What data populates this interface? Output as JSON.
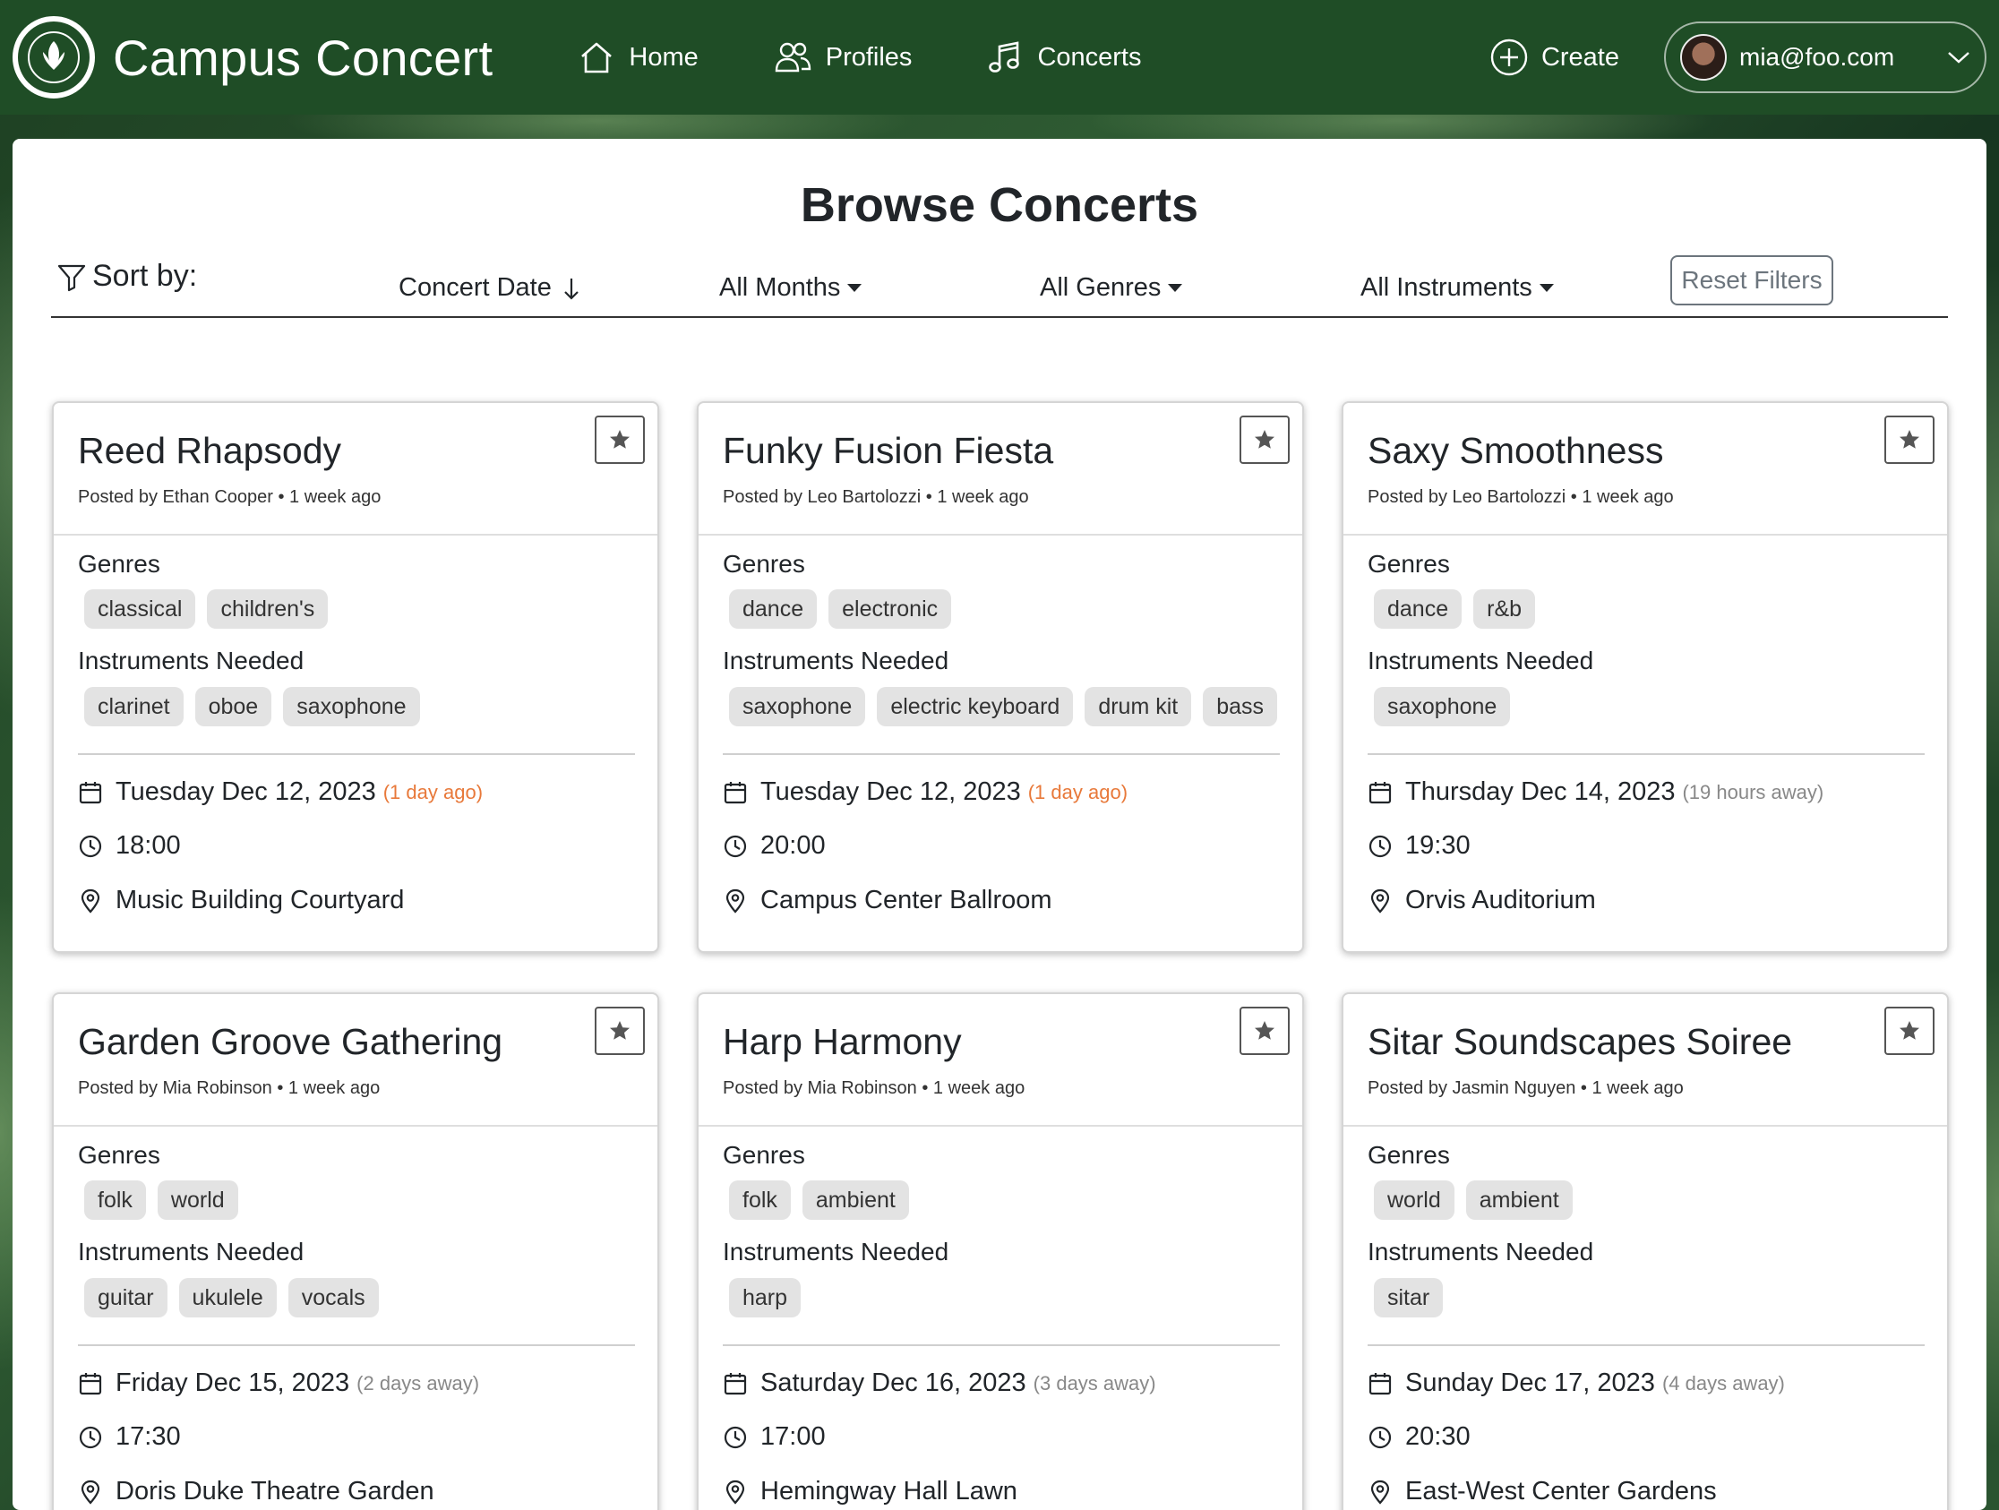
{
  "brand": {
    "name": "Campus Concert"
  },
  "nav": [
    {
      "label": "Home",
      "icon": "home-icon"
    },
    {
      "label": "Profiles",
      "icon": "people-icon"
    },
    {
      "label": "Concerts",
      "icon": "music-note-icon"
    }
  ],
  "create_label": "Create",
  "user": {
    "email": "mia@foo.com"
  },
  "page": {
    "title": "Browse Concerts"
  },
  "filters": {
    "sort_label": "Sort by:",
    "sort_value": "Concert Date",
    "months": "All Months",
    "genres": "All Genres",
    "instruments": "All Instruments",
    "reset": "Reset Filters"
  },
  "labels": {
    "genres": "Genres",
    "instruments": "Instruments Needed"
  },
  "colors": {
    "navbar": "#1f4d26",
    "past_date": "#e8793a",
    "future_date": "#888888"
  },
  "concerts": [
    {
      "title": "Reed Rhapsody",
      "meta": "Posted by Ethan Cooper • 1 week ago",
      "genres": [
        "classical",
        "children's"
      ],
      "instruments": [
        "clarinet",
        "oboe",
        "saxophone"
      ],
      "date": "Tuesday Dec 12, 2023",
      "relative": "(1 day ago)",
      "past": true,
      "time": "18:00",
      "location": "Music Building Courtyard"
    },
    {
      "title": "Funky Fusion Fiesta",
      "meta": "Posted by Leo Bartolozzi • 1 week ago",
      "genres": [
        "dance",
        "electronic"
      ],
      "instruments": [
        "saxophone",
        "electric keyboard",
        "drum kit",
        "bass"
      ],
      "date": "Tuesday Dec 12, 2023",
      "relative": "(1 day ago)",
      "past": true,
      "time": "20:00",
      "location": "Campus Center Ballroom"
    },
    {
      "title": "Saxy Smoothness",
      "meta": "Posted by Leo Bartolozzi • 1 week ago",
      "genres": [
        "dance",
        "r&b"
      ],
      "instruments": [
        "saxophone"
      ],
      "date": "Thursday Dec 14, 2023",
      "relative": "(19 hours away)",
      "past": false,
      "time": "19:30",
      "location": "Orvis Auditorium"
    },
    {
      "title": "Garden Groove Gathering",
      "meta": "Posted by Mia Robinson • 1 week ago",
      "genres": [
        "folk",
        "world"
      ],
      "instruments": [
        "guitar",
        "ukulele",
        "vocals"
      ],
      "date": "Friday Dec 15, 2023",
      "relative": "(2 days away)",
      "past": false,
      "time": "17:30",
      "location": "Doris Duke Theatre Garden"
    },
    {
      "title": "Harp Harmony",
      "meta": "Posted by Mia Robinson • 1 week ago",
      "genres": [
        "folk",
        "ambient"
      ],
      "instruments": [
        "harp"
      ],
      "date": "Saturday Dec 16, 2023",
      "relative": "(3 days away)",
      "past": false,
      "time": "17:00",
      "location": "Hemingway Hall Lawn"
    },
    {
      "title": "Sitar Soundscapes Soiree",
      "meta": "Posted by Jasmin Nguyen • 1 week ago",
      "genres": [
        "world",
        "ambient"
      ],
      "instruments": [
        "sitar"
      ],
      "date": "Sunday Dec 17, 2023",
      "relative": "(4 days away)",
      "past": false,
      "time": "20:30",
      "location": "East-West Center Gardens"
    }
  ]
}
